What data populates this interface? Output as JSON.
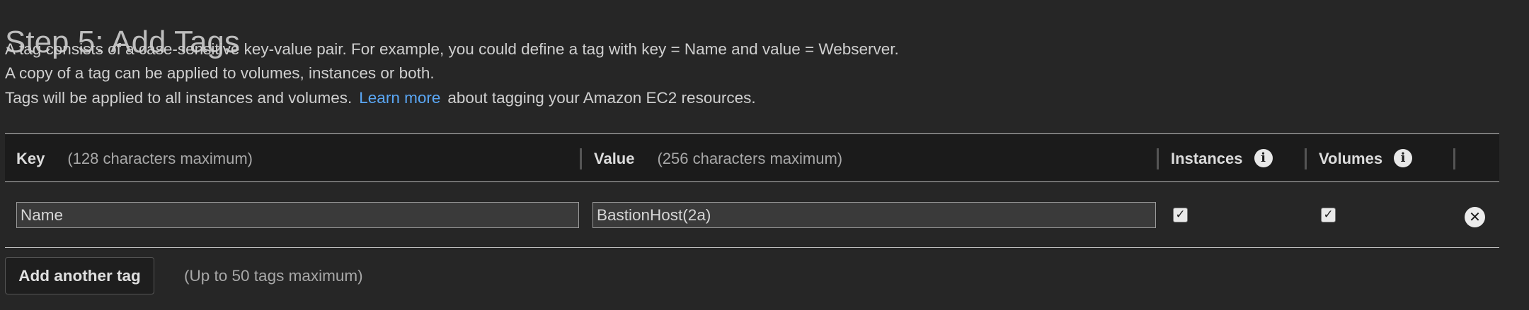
{
  "page": {
    "title": "Step 5: Add Tags",
    "desc_line1": "A tag consists of a case-sensitive key-value pair. For example, you could define a tag with key = Name and value = Webserver.",
    "desc_line2": "A copy of a tag can be applied to volumes, instances or both.",
    "desc_line3_prefix": "Tags will be applied to all instances and volumes.",
    "desc_line3_link": "Learn more",
    "desc_line3_suffix": "about tagging your Amazon EC2 resources."
  },
  "table": {
    "columns": {
      "key_label": "Key",
      "key_hint": "(128 characters maximum)",
      "value_label": "Value",
      "value_hint": "(256 characters maximum)",
      "instances_label": "Instances",
      "volumes_label": "Volumes"
    },
    "rows": [
      {
        "key": "Name",
        "value": "BastionHost(2a)",
        "instances": true,
        "volumes": true
      }
    ]
  },
  "footer": {
    "add_button_label": "Add another tag",
    "add_hint": "(Up to 50 tags maximum)"
  },
  "icons": {
    "info": "info-icon",
    "remove": "close-circle-icon",
    "checkbox": "checkbox-checked-icon"
  }
}
